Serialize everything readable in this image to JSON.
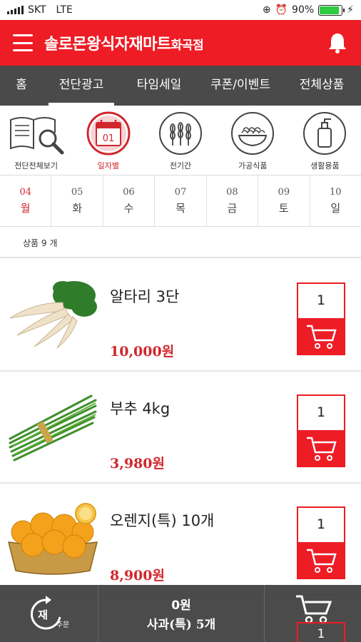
{
  "status_bar": {
    "carrier": "SKT",
    "network": "LTE",
    "battery": "90%"
  },
  "header": {
    "title": "솔로몬왕식자재마트",
    "branch": "화곡점"
  },
  "nav": {
    "items": [
      "홈",
      "전단광고",
      "타임세일",
      "쿠폰/이벤트",
      "전체상품"
    ],
    "active": 1
  },
  "categories": [
    {
      "label": "전단전체보기",
      "icon": "flyer-search-icon"
    },
    {
      "label": "일자별",
      "icon": "calendar-icon",
      "badge": "01"
    },
    {
      "label": "전기간",
      "icon": "wheat-icon"
    },
    {
      "label": "가공식품",
      "icon": "noodle-bowl-icon"
    },
    {
      "label": "생활용품",
      "icon": "pump-bottle-icon"
    }
  ],
  "dates": [
    {
      "day": "04",
      "weekday": "월"
    },
    {
      "day": "05",
      "weekday": "화"
    },
    {
      "day": "06",
      "weekday": "수"
    },
    {
      "day": "07",
      "weekday": "목"
    },
    {
      "day": "08",
      "weekday": "금"
    },
    {
      "day": "09",
      "weekday": "토"
    },
    {
      "day": "10",
      "weekday": "일"
    }
  ],
  "product_count": "상품 9 개",
  "products": [
    {
      "name": "알타리 3단",
      "price": "10,000원",
      "qty": "1"
    },
    {
      "name": "부추 4kg",
      "price": "3,980원",
      "qty": "1"
    },
    {
      "name": "오렌지(특) 10개",
      "price": "8,900원",
      "qty": "1"
    }
  ],
  "bottom_bar": {
    "reorder_label": "재주문",
    "reorder_sub": "주문",
    "reorder_main": "재",
    "total": "0원",
    "peek_name": "사과(특) 5개",
    "peek_qty": "1"
  },
  "colors": {
    "brand_red": "#ee1c25",
    "nav_gray": "#4a4a4a",
    "price_red": "#d0272d"
  }
}
